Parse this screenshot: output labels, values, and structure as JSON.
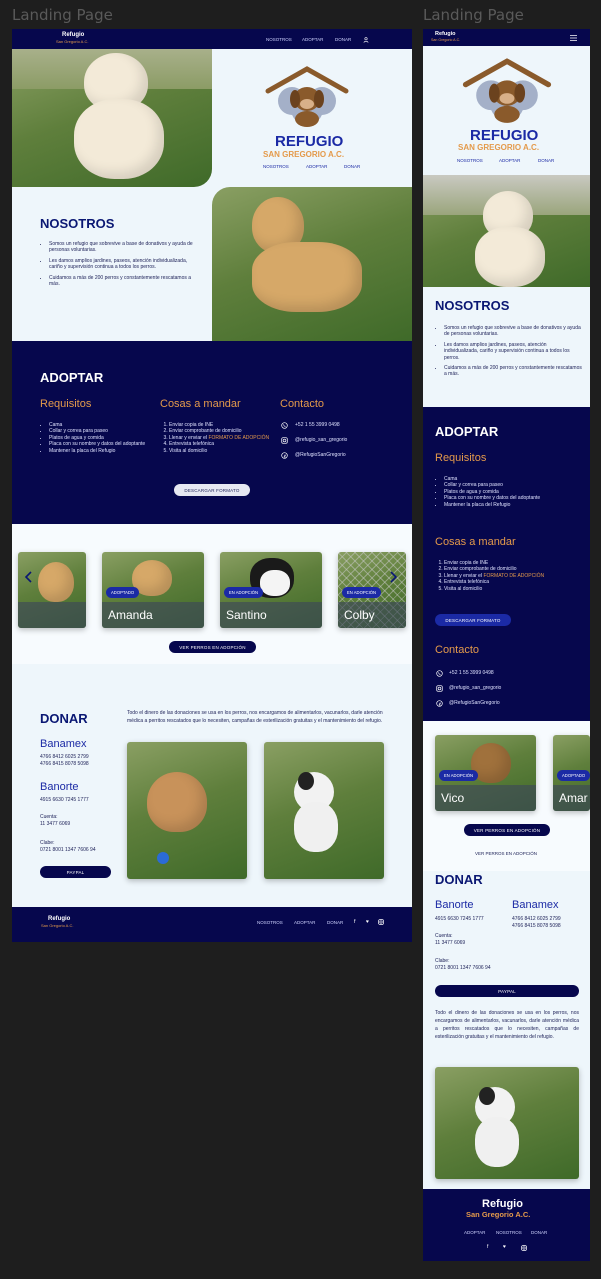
{
  "canvas": {
    "frame_labels": [
      "Landing Page",
      "Landing Page"
    ]
  },
  "desktop": {
    "nav": {
      "brand_title": "Refugio",
      "brand_sub": "San Gregorio A.C.",
      "links": [
        "NOSOTROS",
        "ADOPTAR",
        "DONAR"
      ],
      "user_icon": "user-icon"
    },
    "hero": {
      "title": "REFUGIO",
      "subtitle": "SAN GREGORIO A.C.",
      "links": [
        "NOSOTROS",
        "ADOPTAR",
        "DONAR"
      ]
    },
    "nosotros": {
      "title": "NOSOTROS",
      "items": [
        "Somos un refugio que sobrevive a base de donativos y ayuda de personas voluntarias.",
        "Les damos amplios jardines, paseos, atención individualizada, cariño y supervisión continua a todos los perros.",
        "Cuidamos a más de 200 perros y constantemente rescatamos a más."
      ]
    },
    "adoptar": {
      "title": "ADOPTAR",
      "requisitos_title": "Requisitos",
      "requisitos": [
        "Cama",
        "Collar y correa para paseo",
        "Platos de agua y comida",
        "Placa con su nombre y datos del adoptante",
        "Mantener la placa del Refugio"
      ],
      "cosas_title": "Cosas a mandar",
      "cosas": [
        "Enviar copia de INE",
        "Enviar comprobante de domicilio",
        "Llenar y enviar el",
        "Entrevista telefónica",
        "Visita al domicilio"
      ],
      "cosas_link": "FORMATO DE ADOPCIÓN",
      "contacto_title": "Contacto",
      "contacto": [
        "+52 1 55 3999 0498",
        "@refugio_san_gregorio",
        "@RefugioSanGregorio"
      ],
      "download_btn": "DESCARGAR FORMATO"
    },
    "carousel": {
      "cards": [
        {
          "name": "",
          "badge": ""
        },
        {
          "name": "Amanda",
          "badge": "ADOPTADO"
        },
        {
          "name": "Santino",
          "badge": "EN ADOPCIÓN"
        },
        {
          "name": "Colby",
          "badge": "EN ADOPCIÓN"
        }
      ],
      "cta": "VER PERROS EN ADOPCIÓN"
    },
    "donar": {
      "title": "DONAR",
      "intro": "Todo el dinero de las donaciones se usa en los perros, nos encargamos de alimentarlos, vacunarlos, darle atención médica a perritos rescatados que lo necesiten, campañas de esterilización gratuitas y el mantenimiento del refugio.",
      "banamex_title": "Banamex",
      "banamex_lines": [
        "4766 8412 6025 2799",
        "4766 8415 8078 5098"
      ],
      "banorte_title": "Banorte",
      "banorte_line": "4915 6630 7245 1777",
      "cuenta_label": "Cuenta:",
      "cuenta": "11 3477 6069",
      "clabe_label": "Clabe:",
      "clabe": "0721 8001 1347 7606 94",
      "paypal": "PAYPAL"
    },
    "footer": {
      "brand_title": "Refugio",
      "brand_sub": "San Gregorio A.C.",
      "links": [
        "NOSOTROS",
        "ADOPTAR",
        "DONAR"
      ]
    }
  },
  "mobile": {
    "nav": {
      "brand_title": "Refugio",
      "brand_sub": "San Gregorio A.C."
    },
    "hero": {
      "title": "REFUGIO",
      "subtitle": "SAN GREGORIO A.C.",
      "links": [
        "NOSOTROS",
        "ADOPTAR",
        "DONAR"
      ]
    },
    "nosotros": {
      "title": "NOSOTROS",
      "items": [
        "Somos un refugio que sobrevive a base de donativos y ayuda de personas voluntarias.",
        "Les damos amplios jardines, paseos, atención individualizada, cariño y supervisión continua a todos los perros.",
        "Cuidamos a más de 200 perros y constantemente rescatamos a más."
      ]
    },
    "adoptar": {
      "title": "ADOPTAR",
      "requisitos_title": "Requisitos",
      "requisitos": [
        "Cama",
        "Collar y correa para paseo",
        "Platos de agua y comida",
        "Placa con su nombre y datos del adoptante",
        "Mantener la placa del Refugio"
      ],
      "cosas_title": "Cosas a mandar",
      "cosas": [
        "Enviar copia de INE",
        "Enviar comprobante de domicilio",
        "Llenar y enviar el",
        "Entrevista telefónica",
        "Visita al domicilio"
      ],
      "cosas_link": "FORMATO DE ADOPCIÓN",
      "download_btn": "DESCARGAR FORMATO",
      "contacto_title": "Contacto",
      "contacto": [
        "+52 1 55 3999 0498",
        "@refugio_san_gregorio",
        "@RefugioSanGregorio"
      ]
    },
    "carousel": {
      "cards": [
        {
          "name": "Vico",
          "badge": "EN ADOPCIÓN"
        },
        {
          "name": "Amar",
          "badge": "ADOPTADO"
        }
      ],
      "cta": "VER PERROS EN ADOPCIÓN",
      "cta2": "VER PERROS EN ADOPCIÓN"
    },
    "donar": {
      "title": "DONAR",
      "banorte_title": "Banorte",
      "banorte_line": "4915 6630 7245 1777",
      "banamex_title": "Banamex",
      "banamex_lines": [
        "4766 8412 6025 2799",
        "4766 8415 8078 5098"
      ],
      "cuenta_label": "Cuenta:",
      "cuenta": "11 3477 6069",
      "clabe_label": "Clabe:",
      "clabe": "0721 8001 1347 7606 94",
      "paypal": "PAYPAL",
      "intro": "Todo el dinero de las donaciones se usa en los perros, nos encargamos de alimentarlos, vacunarlos, darle atención médica a perritos rescatados que lo necesiten, campañas de esterilización gratuitas y el mantenimiento del refugio."
    },
    "footer": {
      "brand_title": "Refugio",
      "brand_sub": "San Gregorio A.C.",
      "links": [
        "ADOPTAR",
        "NOSOTROS",
        "DONAR"
      ]
    }
  }
}
